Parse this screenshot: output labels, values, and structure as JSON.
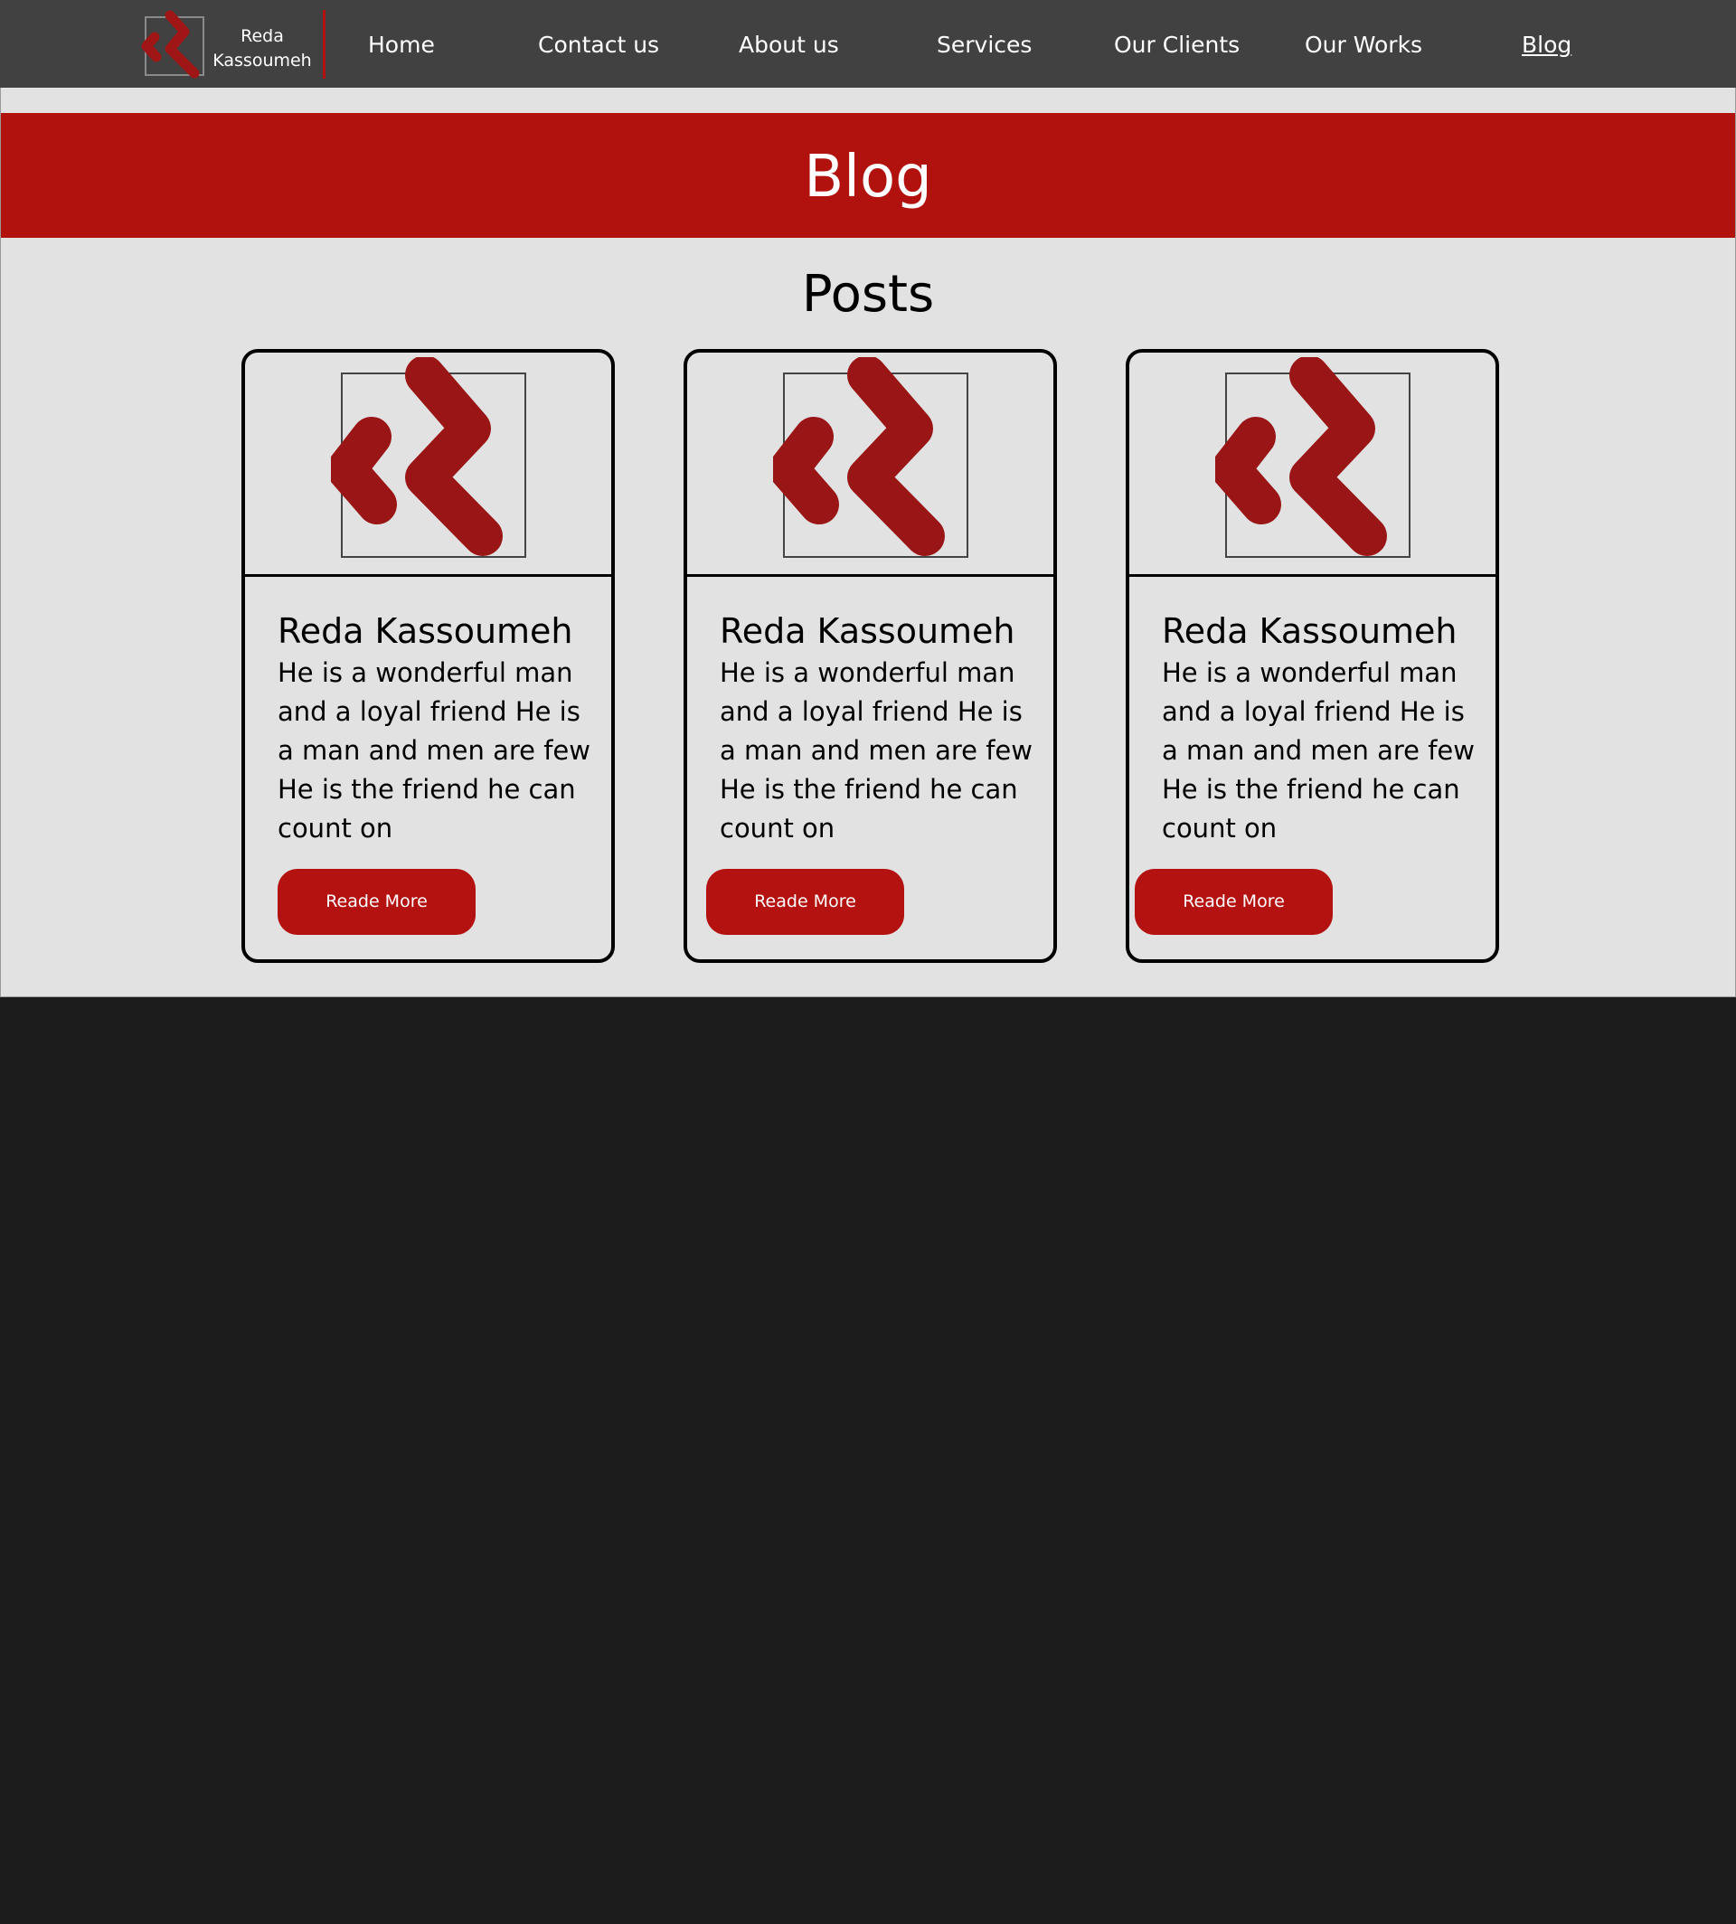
{
  "colors": {
    "navbar": "#414141",
    "accent": "#b1120e",
    "content_bg": "#e2e2e2",
    "page_bg": "#1c1c1c"
  },
  "navbar": {
    "brand": {
      "name_line1": "Reda",
      "name_line2": "Kassoumeh",
      "logo_icon": "rk-logo-icon"
    },
    "items": [
      {
        "label": "Home",
        "active": false
      },
      {
        "label": "Contact us",
        "active": false
      },
      {
        "label": "About us",
        "active": false
      },
      {
        "label": "Services",
        "active": false
      },
      {
        "label": "Our Clients",
        "active": false
      },
      {
        "label": "Our Works",
        "active": false
      },
      {
        "label": "Blog",
        "active": true
      }
    ]
  },
  "banner": {
    "title": "Blog"
  },
  "posts": {
    "section_title": "Posts",
    "items": [
      {
        "image_icon": "rk-logo-icon",
        "title": "Reda Kassoumeh",
        "text": "He is a wonderful man and a loyal friend He is a man and men are few He is the friend he can count on",
        "button_label": "Reade More"
      },
      {
        "image_icon": "rk-logo-icon",
        "title": "Reda Kassoumeh",
        "text": "He is a wonderful man and a loyal friend He is a man and men are few He is the friend he can count on",
        "button_label": "Reade More"
      },
      {
        "image_icon": "rk-logo-icon",
        "title": "Reda Kassoumeh",
        "text": "He is a wonderful man and a loyal friend He is a man and men are few He is the friend he can count on",
        "button_label": "Reade More"
      }
    ]
  }
}
